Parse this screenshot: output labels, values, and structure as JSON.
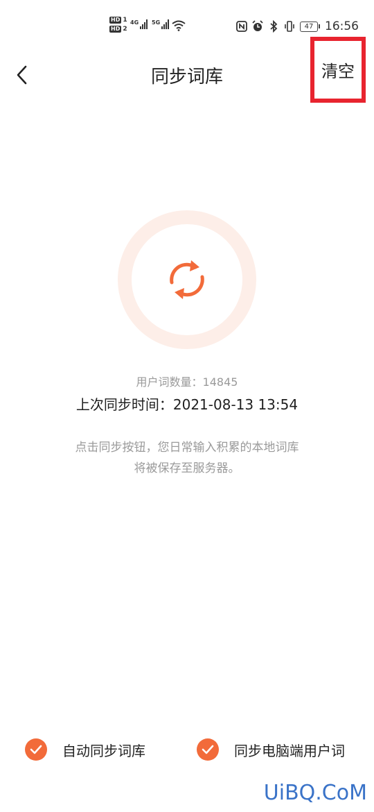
{
  "status_bar": {
    "sim1_label": "HD",
    "sim1_num": "1",
    "sim2_label": "HD",
    "sim2_num": "2",
    "net1": "4G",
    "net2": "5G",
    "battery": "47",
    "time": "16:56",
    "icons": [
      "nfc-icon",
      "alarm-icon",
      "bluetooth-icon",
      "vibrate-icon"
    ]
  },
  "header": {
    "title": "同步词库",
    "clear_label": "清空",
    "back_icon": "chevron-left-icon"
  },
  "sync": {
    "icon": "sync-icon",
    "accent": "#f26b3a",
    "ring_color": "#fdeee8",
    "count_text": "用户词数量：14845",
    "last_sync_text": "上次同步时间：2021-08-13 13:54",
    "hint_line1": "点击同步按钮，您日常输入积累的本地词库",
    "hint_line2": "将被保存至服务器。"
  },
  "options": [
    {
      "label": "自动同步词库",
      "checked": true
    },
    {
      "label": "同步电脑端用户词",
      "checked": true
    }
  ],
  "watermark": "UiBQ.CoM"
}
